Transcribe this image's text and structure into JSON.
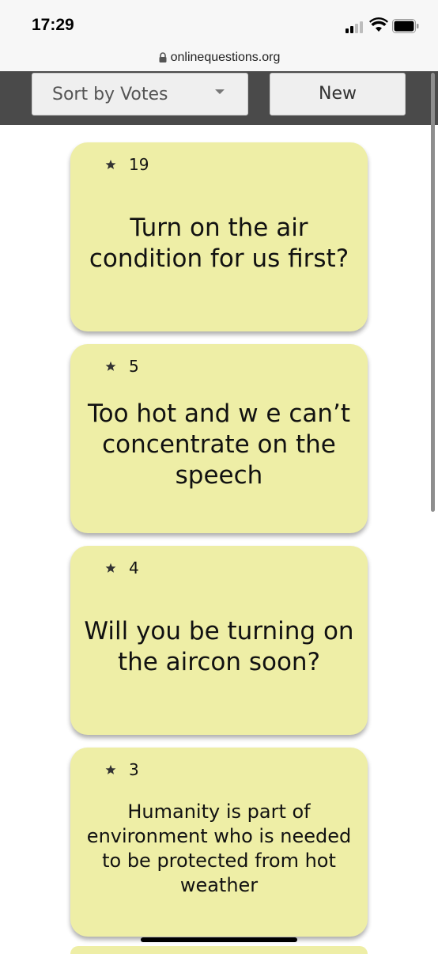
{
  "status_bar": {
    "time": "17:29"
  },
  "browser": {
    "url": "onlinequestions.org"
  },
  "toolbar": {
    "sort_label": "Sort by Votes",
    "new_label": "New"
  },
  "questions": [
    {
      "votes": "19",
      "text": "Turn on the air condition for us first?"
    },
    {
      "votes": "5",
      "text": "Too hot and w e can’t concentrate on the speech"
    },
    {
      "votes": "4",
      "text": "Will you be turning on the aircon soon?"
    },
    {
      "votes": "3",
      "text": "Humanity is part of environment who is needed to be protected from hot weather"
    }
  ],
  "colors": {
    "card_background": "#eeeea6",
    "toolbar_background": "#4a4a4a",
    "button_background": "#efefef"
  }
}
